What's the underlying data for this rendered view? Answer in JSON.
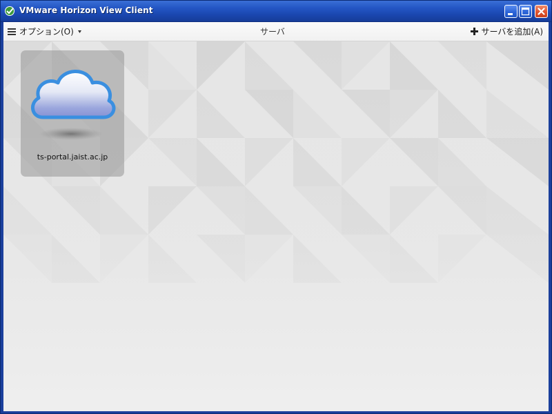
{
  "window": {
    "title": "VMware Horizon View Client",
    "accent": "#2456c4",
    "close_color": "#e0532e"
  },
  "toolbar": {
    "options_label": "オプション(O)",
    "heading": "サーバ",
    "add_server_label": "サーバを追加(A)"
  },
  "servers": [
    {
      "name": "ts-portal.jaist.ac.jp",
      "icon": "cloud-icon"
    }
  ],
  "icons": {
    "app": "vmware-app-icon",
    "options": "hamburger-menu-icon",
    "add": "plus-icon",
    "minimize": "minimize-icon",
    "maximize": "maximize-icon",
    "close": "close-icon"
  }
}
